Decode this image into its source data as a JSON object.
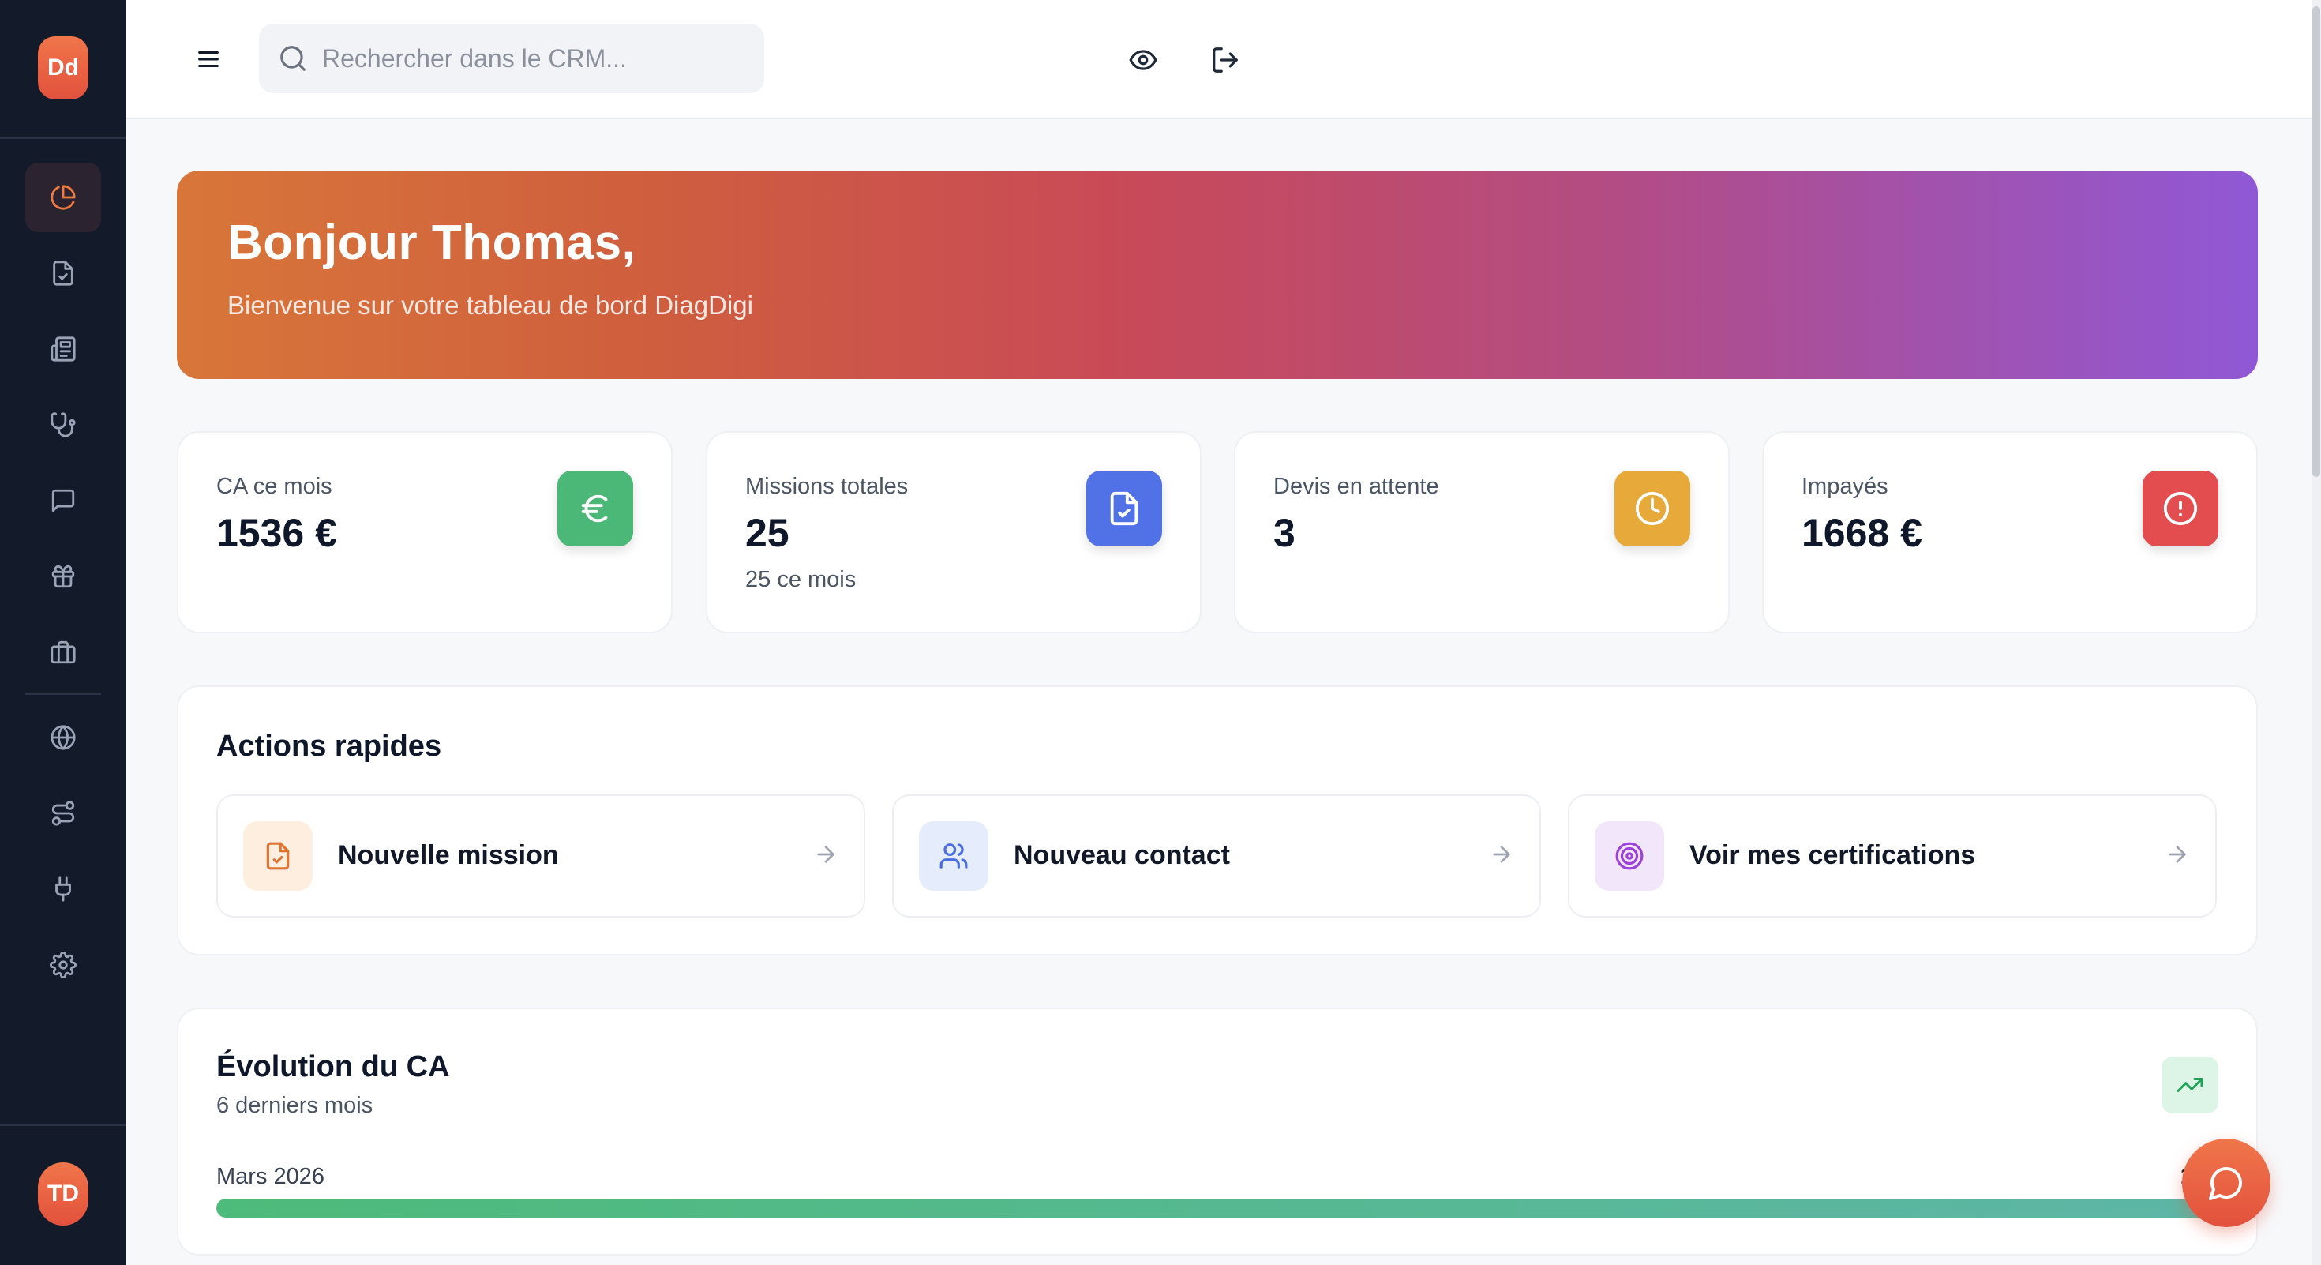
{
  "sidebar": {
    "logo_text": "Dd",
    "avatar_text": "TD",
    "items": [
      {
        "icon": "pie-chart-icon",
        "active": true
      },
      {
        "icon": "file-check-icon"
      },
      {
        "icon": "newspaper-icon"
      },
      {
        "icon": "stethoscope-icon"
      },
      {
        "icon": "message-square-icon"
      },
      {
        "icon": "gift-icon"
      },
      {
        "icon": "briefcase-icon"
      },
      {
        "icon": "globe-icon"
      },
      {
        "icon": "route-icon"
      },
      {
        "icon": "plug-icon"
      },
      {
        "icon": "settings-gear-icon"
      }
    ]
  },
  "header": {
    "search_placeholder": "Rechercher dans le CRM...",
    "icons": [
      "menu-icon",
      "search-icon",
      "eye-icon",
      "logout-icon"
    ]
  },
  "hero": {
    "title": "Bonjour Thomas,",
    "subtitle": "Bienvenue sur votre tableau de bord DiagDigi"
  },
  "stats": [
    {
      "label": "CA ce mois",
      "value": "1536 €",
      "sub": "",
      "icon": "euro-icon",
      "color": "#4cb877"
    },
    {
      "label": "Missions totales",
      "value": "25",
      "sub": "25 ce mois",
      "icon": "file-check-icon",
      "color": "#5172e6"
    },
    {
      "label": "Devis en attente",
      "value": "3",
      "sub": "",
      "icon": "clock-icon",
      "color": "#e7a93a"
    },
    {
      "label": "Impayés",
      "value": "1668 €",
      "sub": "",
      "icon": "alert-circle-icon",
      "color": "#e34d4f"
    }
  ],
  "quick_actions": {
    "title": "Actions rapides",
    "items": [
      {
        "label": "Nouvelle mission",
        "icon": "file-check-icon",
        "bg": "#fdeee0",
        "color": "#e0732f"
      },
      {
        "label": "Nouveau contact",
        "icon": "users-icon",
        "bg": "#e5ecfb",
        "color": "#4a6ee0"
      },
      {
        "label": "Voir mes certifications",
        "icon": "target-icon",
        "bg": "#f2e6fb",
        "color": "#9b40d8"
      }
    ]
  },
  "evolution": {
    "title": "Évolution du CA",
    "subtitle": "6 derniers mois",
    "rows": [
      {
        "label": "Mars 2026",
        "value": "153",
        "fill": 1.0
      }
    ]
  },
  "colors": {
    "sidebar_bg": "#131a2a",
    "accent": "#f07a3e",
    "hero_gradient": [
      "#d8763a",
      "#c94a57",
      "#9058d6"
    ]
  }
}
